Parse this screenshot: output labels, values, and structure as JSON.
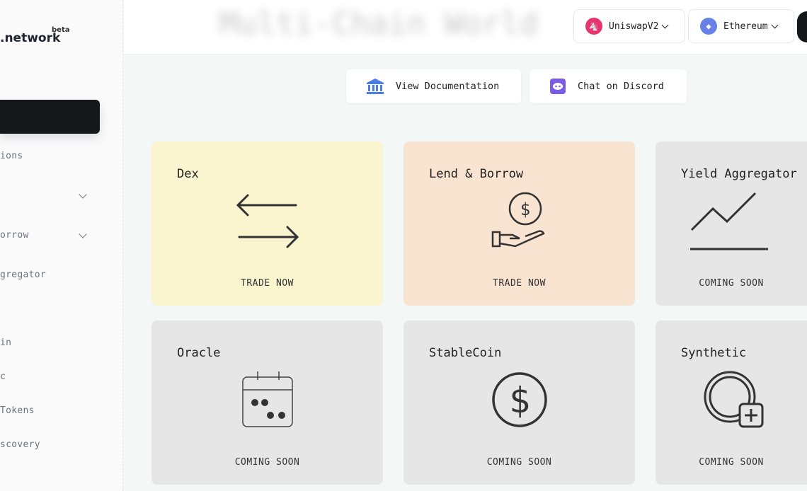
{
  "sidebar": {
    "logo": ".network",
    "beta": "beta",
    "items": [
      {
        "label": "ions",
        "chevron": false
      },
      {
        "label": "",
        "chevron": true
      },
      {
        "label": "orrow",
        "chevron": true
      },
      {
        "label": "gregator",
        "chevron": false
      },
      {
        "label": "in",
        "chevron": false
      },
      {
        "label": "c",
        "chevron": false
      },
      {
        "label": " Tokens",
        "chevron": false
      },
      {
        "label": "scovery",
        "chevron": false
      }
    ]
  },
  "header": {
    "title": "Multi-Chain World",
    "protocol": {
      "label": "UniswapV2",
      "icon": "unicorn-icon",
      "color": "#e8336d"
    },
    "network": {
      "label": "Ethereum",
      "icon": "ethereum-icon",
      "color": "#6781e9"
    }
  },
  "links": {
    "docs": "View Documentation",
    "discord": "Chat on Discord"
  },
  "cards": [
    {
      "title": "Dex",
      "action": "TRADE NOW",
      "icon": "swap-arrows-icon",
      "color": "#faf5cf"
    },
    {
      "title": "Lend & Borrow",
      "action": "TRADE NOW",
      "icon": "hand-coin-icon",
      "color": "#f9e3d1"
    },
    {
      "title": "Yield Aggregator",
      "action": "COMING SOON",
      "icon": "trend-up-icon",
      "color": "#e6e6e6"
    },
    {
      "title": "Oracle",
      "action": "COMING SOON",
      "icon": "calendar-icon",
      "color": "#e6e6e6"
    },
    {
      "title": "StableCoin",
      "action": "COMING SOON",
      "icon": "dollar-circle-icon",
      "color": "#e6e6e6"
    },
    {
      "title": "Synthetic",
      "action": "COMING SOON",
      "icon": "coin-plus-icon",
      "color": "#e6e6e6"
    }
  ]
}
